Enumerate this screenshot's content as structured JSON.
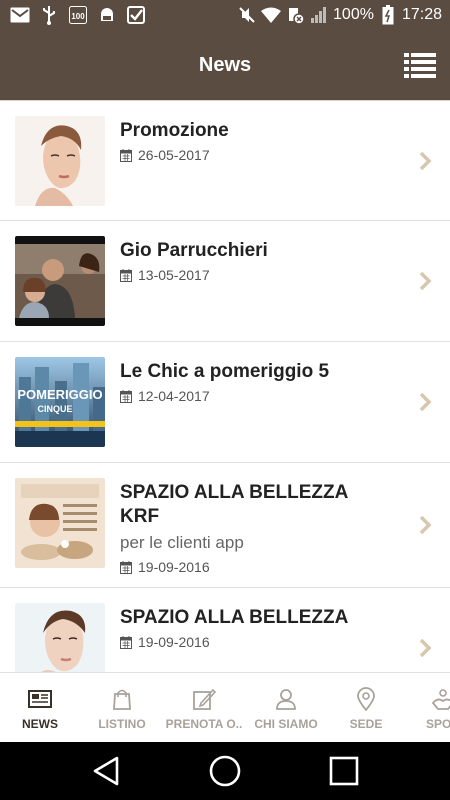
{
  "status_bar": {
    "left_icons": [
      "gmail-icon",
      "usb-icon",
      "app-100-icon",
      "android-debug-icon",
      "check-icon"
    ],
    "right_icons": [
      "mute-icon",
      "wifi-icon",
      "data-saver-icon",
      "signal-icon",
      "battery-icon"
    ],
    "battery_text": "100%",
    "time": "17:28"
  },
  "app_bar": {
    "title": "News",
    "menu_icon": "list-menu-icon"
  },
  "news": [
    {
      "title": "Promozione",
      "subtitle": "",
      "date": "26-05-2017"
    },
    {
      "title": "Gio Parrucchieri",
      "subtitle": "",
      "date": "13-05-2017"
    },
    {
      "title": "Le Chic a pomeriggio 5",
      "subtitle": "",
      "date": "12-04-2017"
    },
    {
      "title": "SPAZIO ALLA BELLEZZA KRF",
      "subtitle": "per le clienti app",
      "date": "19-09-2016"
    },
    {
      "title": "SPAZIO ALLA BELLEZZA",
      "subtitle": "",
      "date": "19-09-2016"
    }
  ],
  "thumbnail_text": {
    "pomeriggio": "POMERIGGIO",
    "cinque": "CINQUE"
  },
  "tabs": [
    {
      "label": "NEWS",
      "icon": "newspaper-icon",
      "active": true
    },
    {
      "label": "LISTINO",
      "icon": "shopping-bag-icon",
      "active": false
    },
    {
      "label": "PRENOTA O..",
      "icon": "edit-icon",
      "active": false
    },
    {
      "label": "CHI SIAMO",
      "icon": "person-icon",
      "active": false
    },
    {
      "label": "SEDE",
      "icon": "map-pin-icon",
      "active": false
    },
    {
      "label": "SPON",
      "icon": "hands-icon",
      "active": false
    }
  ],
  "nav_bar": {
    "buttons": [
      "back-icon",
      "home-icon",
      "recents-icon"
    ]
  },
  "colors": {
    "brand": "#5a4c41",
    "chevron": "#d7c7ae",
    "text": "#222222",
    "muted": "#666666"
  }
}
